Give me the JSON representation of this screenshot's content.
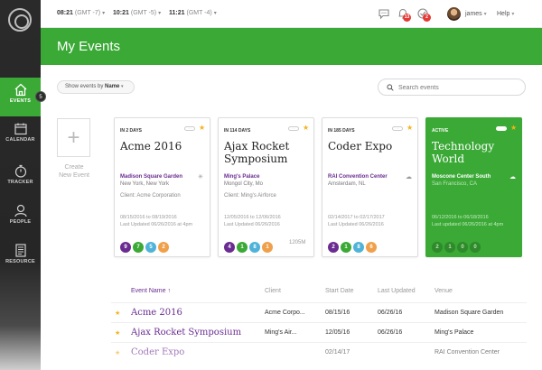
{
  "sidebar": {
    "items": [
      {
        "label": "EVENTS",
        "icon": "home-icon",
        "active": true,
        "badge": "5"
      },
      {
        "label": "CALENDAR",
        "icon": "calendar-icon"
      },
      {
        "label": "TRACKER",
        "icon": "stopwatch-icon"
      },
      {
        "label": "PEOPLE",
        "icon": "person-icon"
      },
      {
        "label": "RESOURCE",
        "icon": "document-icon"
      }
    ]
  },
  "topbar": {
    "clocks": [
      {
        "time": "08:21",
        "tz": "(GMT -7)"
      },
      {
        "time": "10:21",
        "tz": "(GMT -5)"
      },
      {
        "time": "11:21",
        "tz": "(GMT -4)"
      }
    ],
    "notifications": {
      "bell_count": "13",
      "tasks_count": "2"
    },
    "user_name": "james",
    "help_label": "Help"
  },
  "header": {
    "title": "My Events"
  },
  "filter": {
    "prefix": "Show events by",
    "value": "Name"
  },
  "search": {
    "placeholder": "Search events"
  },
  "create": {
    "label_line1": "Create",
    "label_line2": "New Event"
  },
  "cards": [
    {
      "days": "IN 2 DAYS",
      "name": "Acme 2016",
      "venue": "Madison Square Garden",
      "city": "New York, New York",
      "client": "Client: Acme Corporation",
      "dates": "08/15/2016 to 08/19/2016",
      "updated": "Last Updated 06/26/2016 at 4pm",
      "counts": [
        "9",
        "7",
        "5",
        "2"
      ],
      "size": ""
    },
    {
      "days": "IN 114 DAYS",
      "name": "Ajax Rocket Symposium",
      "venue": "Ming's Palace",
      "city": "Mongol City, Mo",
      "client": "Client: Ming's Airforce",
      "dates": "12/05/2016 to 12/06/2016",
      "updated": "Last Updated 06/26/2016",
      "counts": [
        "4",
        "1",
        "8",
        "1"
      ],
      "size": "1205M"
    },
    {
      "days": "IN 185 DAYS",
      "name": "Coder Expo",
      "venue": "RAI Convention Center",
      "city": "Amsterdam, NL",
      "client": "",
      "dates": "02/14/2017 to 02/17/2017",
      "updated": "Last Updated 06/26/2016",
      "counts": [
        "2",
        "1",
        "8",
        "6"
      ],
      "size": ""
    },
    {
      "days": "ACTIVE",
      "name": "Technology World",
      "venue": "Moscone Center South",
      "city": "San Francisco, CA",
      "client": "",
      "dates": "06/12/2016 to 06/18/2016",
      "updated": "Last updated 06/26/2016 at 4pm",
      "counts": [
        "2",
        "1",
        "0",
        "0"
      ],
      "size": ""
    }
  ],
  "dot_colors": [
    "#6a2c91",
    "#3aa935",
    "#4fb3d9",
    "#f0a04b"
  ],
  "table": {
    "headers": [
      "Event Name ↑",
      "Client",
      "Start Date",
      "Last Updated",
      "Venue"
    ],
    "rows": [
      [
        "Acme 2016",
        "Acme Corpo...",
        "08/15/16",
        "06/26/16",
        "Madison Square Garden"
      ],
      [
        "Ajax Rocket Symposium",
        "Ming's Air...",
        "12/05/16",
        "06/26/16",
        "Ming's Palace"
      ],
      [
        "Coder Expo",
        "",
        "02/14/17",
        "",
        "RAI Convention Center"
      ]
    ]
  }
}
